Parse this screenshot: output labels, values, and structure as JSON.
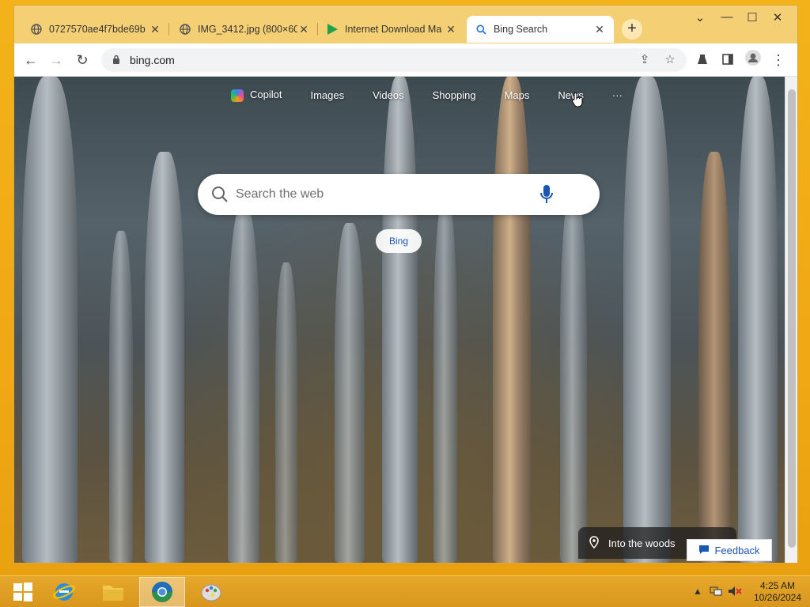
{
  "browser": {
    "tabs": [
      {
        "title": "0727570ae4f7bde69b",
        "icon": "globe-icon",
        "active": false
      },
      {
        "title": "IMG_3412.jpg (800×60",
        "icon": "globe-icon",
        "active": false
      },
      {
        "title": "Internet Download Ma",
        "icon": "play-icon",
        "active": false
      },
      {
        "title": "Bing Search",
        "icon": "search-icon",
        "active": true
      }
    ],
    "address": "bing.com"
  },
  "bing": {
    "nav": {
      "copilot": "Copilot",
      "images": "Images",
      "videos": "Videos",
      "shopping": "Shopping",
      "maps": "Maps",
      "news": "News",
      "more": "···"
    },
    "search_placeholder": "Search the web",
    "pill_label": "Bing",
    "image_caption": "Into the woods",
    "feedback_label": "Feedback"
  },
  "taskbar": {
    "time": "4:25 AM",
    "date": "10/26/2024"
  },
  "colors": {
    "desktop": "#f0a814",
    "tabstrip": "#f5cf73",
    "bing_blue": "#1a56b4"
  }
}
